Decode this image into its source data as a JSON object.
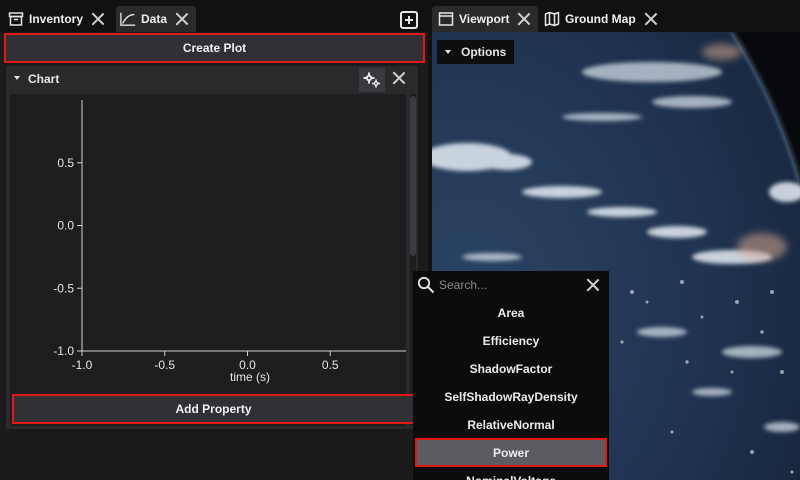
{
  "left_tabs": [
    {
      "label": "Inventory",
      "icon": "archive-icon"
    },
    {
      "label": "Data",
      "icon": "line-chart-icon"
    }
  ],
  "create_plot_label": "Create Plot",
  "chart": {
    "title": "Chart",
    "add_property_label": "Add Property"
  },
  "chart_data": {
    "type": "line",
    "series": [],
    "xlabel": "time (s)",
    "ylabel": "",
    "xlim": [
      -1.0,
      1.0
    ],
    "ylim": [
      -1.0,
      1.0
    ],
    "x_ticks": [
      "-1.0",
      "-0.5",
      "0.0",
      "0.5"
    ],
    "y_ticks": [
      "0.5",
      "0.0",
      "-0.5",
      "-1.0"
    ],
    "grid": false
  },
  "right_tabs": [
    {
      "label": "Viewport",
      "icon": "window-icon"
    },
    {
      "label": "Ground Map",
      "icon": "map-icon"
    }
  ],
  "viewport": {
    "options_label": "Options"
  },
  "dropdown": {
    "search_placeholder": "Search...",
    "items": [
      "Area",
      "Efficiency",
      "ShadowFactor",
      "SelfShadowRayDensity",
      "RelativeNormal",
      "Power",
      "NominalVoltage"
    ],
    "selected": "Power"
  },
  "colors": {
    "highlight": "#e01818",
    "panel": "#2a2a2d",
    "plot_bg": "#1e1e20"
  }
}
